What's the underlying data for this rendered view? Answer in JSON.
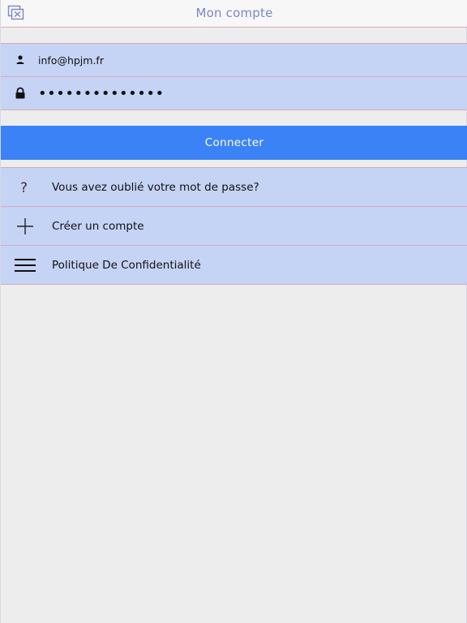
{
  "header": {
    "title": "Mon compte",
    "close_icon": "close-window-icon"
  },
  "login": {
    "email": {
      "icon": "user-icon",
      "value": "info@hpjm.fr"
    },
    "password": {
      "icon": "lock-icon",
      "masked_value": "••••••••••••••"
    },
    "connect_label": "Connecter"
  },
  "menu": {
    "items": [
      {
        "icon": "question-icon",
        "label": "Vous avez oublié votre mot de passe?"
      },
      {
        "icon": "plus-icon",
        "label": "Créer un compte"
      },
      {
        "icon": "hamburger-icon",
        "label": "Politique De Confidentialité"
      }
    ]
  },
  "colors": {
    "accent": "#3b82f6",
    "row_background": "#c5d3f5",
    "header_title": "#7b86c8",
    "separator": "#d9a9b8",
    "page_background": "#ededed"
  }
}
